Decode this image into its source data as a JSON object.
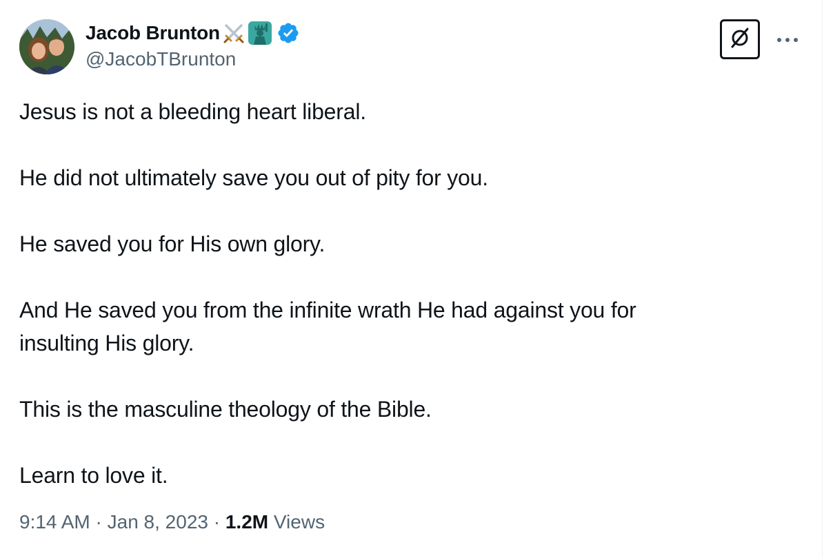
{
  "author": {
    "display_name": "Jacob Brunton",
    "handle": "@JacobTBrunton",
    "emojis": [
      "crossed-swords-icon",
      "statue-of-liberty-icon"
    ],
    "verified": true
  },
  "tweet": {
    "paragraphs": [
      "Jesus is not a bleeding heart liberal.",
      "He did not ultimately save you out of pity for you.",
      "He saved you for His own glory.",
      "And He saved you from the infinite wrath He had against you for insulting His glory.",
      "This is the masculine theology of the Bible.",
      "Learn to love it."
    ]
  },
  "meta": {
    "time": "9:14 AM",
    "separator": " · ",
    "date": "Jan 8, 2023",
    "views_count": "1.2M",
    "views_label": " Views"
  },
  "actions": {
    "grok_icon": "grok-icon",
    "more_icon": "more-dots-icon"
  },
  "colors": {
    "text_primary": "#0f1419",
    "text_secondary": "#536471",
    "verified_blue": "#1d9bf0",
    "divider": "#eff3f4"
  }
}
